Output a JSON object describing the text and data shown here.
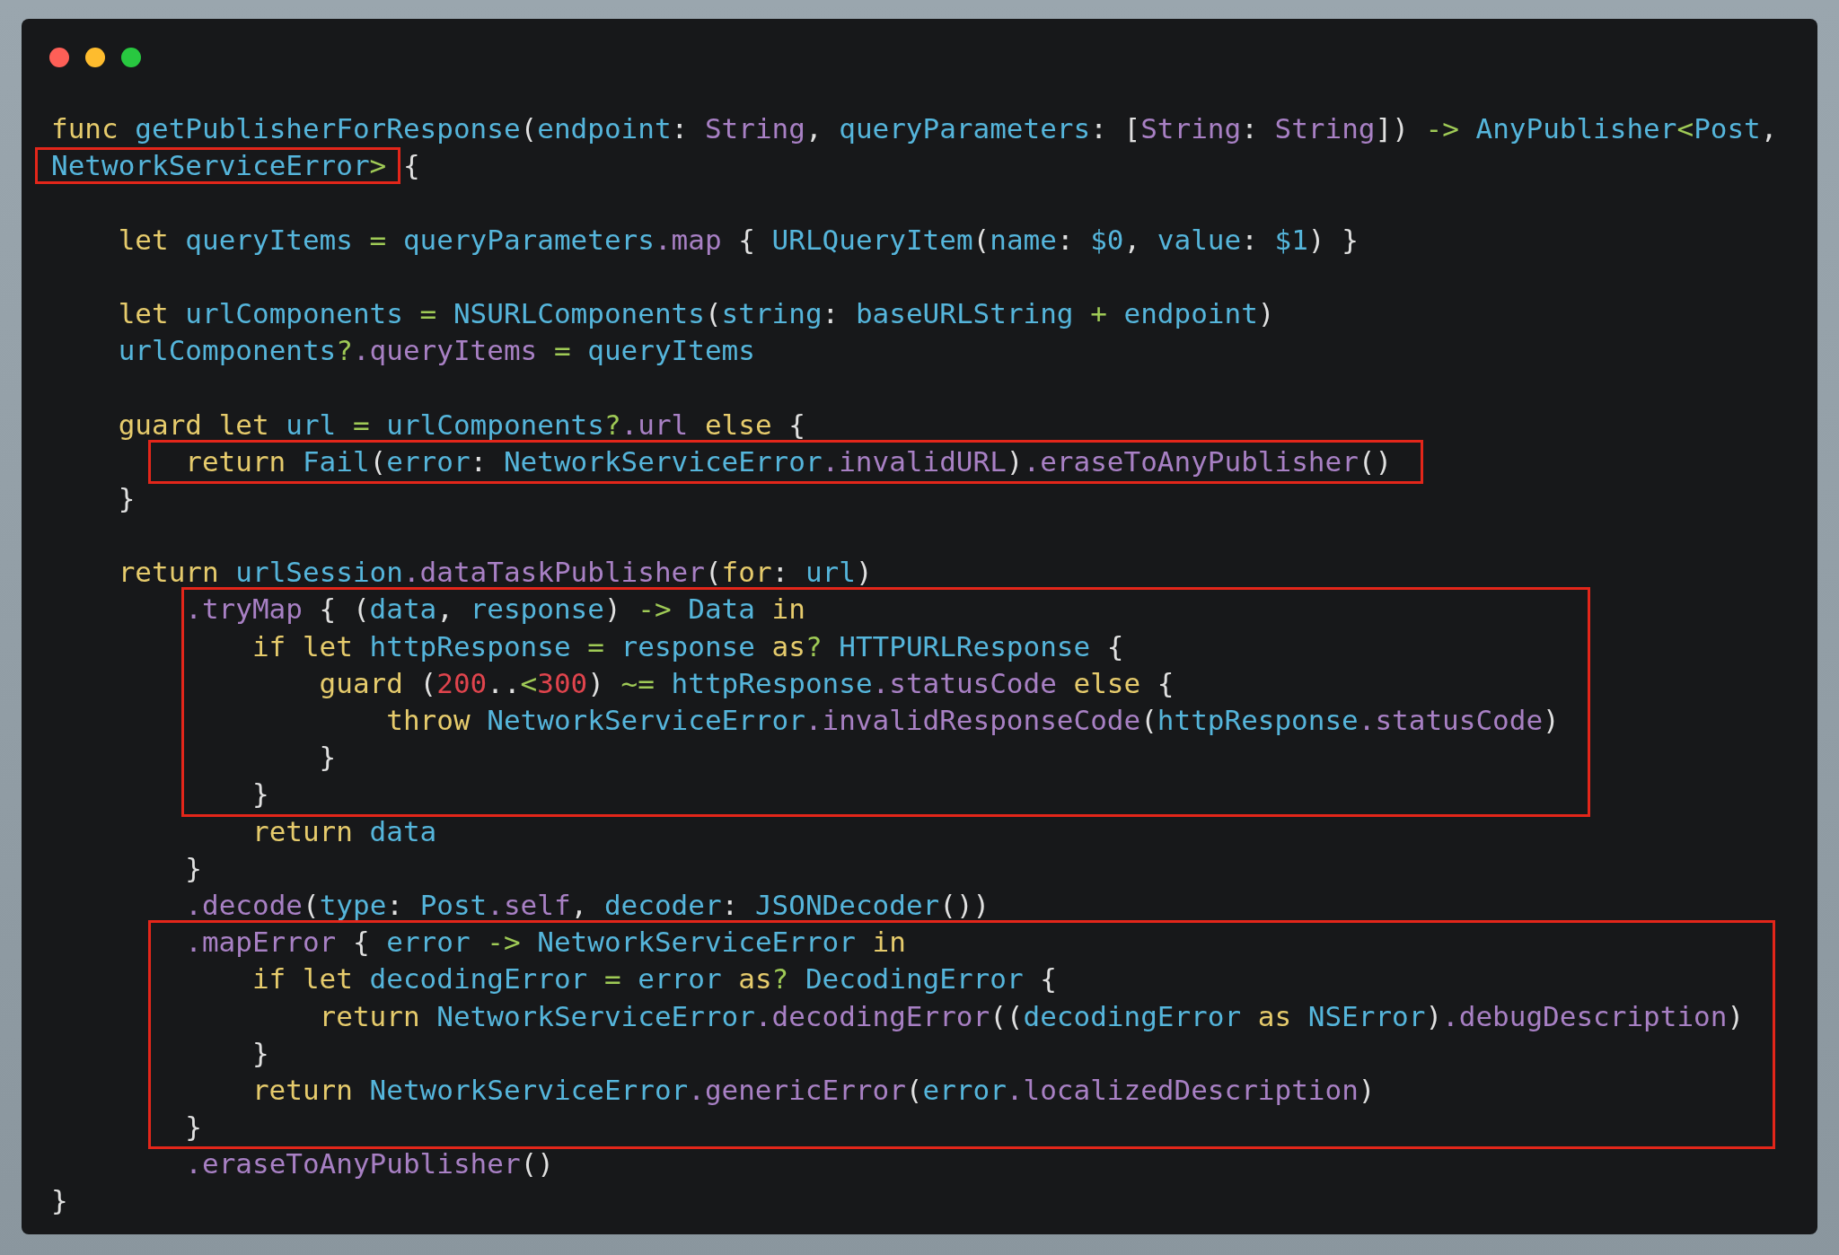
{
  "window": {
    "controls": [
      {
        "kind": "close"
      },
      {
        "kind": "minimize"
      },
      {
        "kind": "zoom"
      }
    ]
  },
  "code": [
    {
      "kind": "line",
      "tokens": [
        {
          "kind": "k",
          "text": "func "
        },
        {
          "kind": "i",
          "text": "getPublisherForResponse"
        },
        {
          "kind": "p",
          "text": "("
        },
        {
          "kind": "i",
          "text": "endpoint"
        },
        {
          "kind": "p",
          "text": ": "
        },
        {
          "kind": "m",
          "text": "String"
        },
        {
          "kind": "p",
          "text": ", "
        },
        {
          "kind": "i",
          "text": "queryParameters"
        },
        {
          "kind": "p",
          "text": ": ["
        },
        {
          "kind": "m",
          "text": "String"
        },
        {
          "kind": "p",
          "text": ": "
        },
        {
          "kind": "m",
          "text": "String"
        },
        {
          "kind": "p",
          "text": "]) "
        },
        {
          "kind": "o",
          "text": "->"
        },
        {
          "kind": "i",
          "text": " AnyPublisher"
        },
        {
          "kind": "o",
          "text": "<"
        },
        {
          "kind": "i",
          "text": "Post"
        },
        {
          "kind": "p",
          "text": ","
        }
      ]
    },
    {
      "kind": "line",
      "tokens": [
        {
          "kind": "box",
          "tokens": [
            {
              "kind": "i",
              "text": "NetworkServiceError"
            },
            {
              "kind": "o",
              "text": ">"
            }
          ]
        },
        {
          "kind": "p",
          "text": " {"
        }
      ]
    },
    {
      "kind": "blank"
    },
    {
      "kind": "line",
      "tokens": [
        {
          "kind": "k",
          "text": "    let "
        },
        {
          "kind": "i",
          "text": "queryItems"
        },
        {
          "kind": "o",
          "text": " = "
        },
        {
          "kind": "i",
          "text": "queryParameters"
        },
        {
          "kind": "m",
          "text": ".map"
        },
        {
          "kind": "p",
          "text": " { "
        },
        {
          "kind": "i",
          "text": "URLQueryItem"
        },
        {
          "kind": "p",
          "text": "("
        },
        {
          "kind": "i",
          "text": "name"
        },
        {
          "kind": "p",
          "text": ": "
        },
        {
          "kind": "i",
          "text": "$0"
        },
        {
          "kind": "p",
          "text": ", "
        },
        {
          "kind": "i",
          "text": "value"
        },
        {
          "kind": "p",
          "text": ": "
        },
        {
          "kind": "i",
          "text": "$1"
        },
        {
          "kind": "p",
          "text": ") }"
        }
      ]
    },
    {
      "kind": "blank"
    },
    {
      "kind": "line",
      "tokens": [
        {
          "kind": "k",
          "text": "    let "
        },
        {
          "kind": "i",
          "text": "urlComponents"
        },
        {
          "kind": "o",
          "text": " = "
        },
        {
          "kind": "i",
          "text": "NSURLComponents"
        },
        {
          "kind": "p",
          "text": "("
        },
        {
          "kind": "i",
          "text": "string"
        },
        {
          "kind": "p",
          "text": ": "
        },
        {
          "kind": "i",
          "text": "baseURLString"
        },
        {
          "kind": "o",
          "text": " + "
        },
        {
          "kind": "i",
          "text": "endpoint"
        },
        {
          "kind": "p",
          "text": ")"
        }
      ]
    },
    {
      "kind": "line",
      "tokens": [
        {
          "kind": "i",
          "text": "    urlComponents"
        },
        {
          "kind": "o",
          "text": "?"
        },
        {
          "kind": "m",
          "text": ".queryItems"
        },
        {
          "kind": "o",
          "text": " = "
        },
        {
          "kind": "i",
          "text": "queryItems"
        }
      ]
    },
    {
      "kind": "blank"
    },
    {
      "kind": "line",
      "tokens": [
        {
          "kind": "k",
          "text": "    guard let "
        },
        {
          "kind": "i",
          "text": "url"
        },
        {
          "kind": "o",
          "text": " = "
        },
        {
          "kind": "i",
          "text": "urlComponents"
        },
        {
          "kind": "o",
          "text": "?"
        },
        {
          "kind": "m",
          "text": ".url"
        },
        {
          "kind": "k",
          "text": " else "
        },
        {
          "kind": "p",
          "text": "{"
        }
      ]
    },
    {
      "kind": "box",
      "tight": false,
      "lines": [
        {
          "kind": "line",
          "tokens": [
            {
              "kind": "k",
              "text": "        return "
            },
            {
              "kind": "i",
              "text": "Fail"
            },
            {
              "kind": "p",
              "text": "("
            },
            {
              "kind": "i",
              "text": "error"
            },
            {
              "kind": "p",
              "text": ": "
            },
            {
              "kind": "i",
              "text": "NetworkServiceError"
            },
            {
              "kind": "m",
              "text": ".invalidURL"
            },
            {
              "kind": "p",
              "text": ")"
            },
            {
              "kind": "m",
              "text": ".eraseToAnyPublisher"
            },
            {
              "kind": "p",
              "text": "()"
            }
          ]
        }
      ]
    },
    {
      "kind": "line",
      "tokens": [
        {
          "kind": "p",
          "text": "    }"
        }
      ]
    },
    {
      "kind": "blank"
    },
    {
      "kind": "line",
      "tokens": [
        {
          "kind": "k",
          "text": "    return "
        },
        {
          "kind": "i",
          "text": "urlSession"
        },
        {
          "kind": "m",
          "text": ".dataTaskPublisher"
        },
        {
          "kind": "p",
          "text": "("
        },
        {
          "kind": "k",
          "text": "for"
        },
        {
          "kind": "p",
          "text": ": "
        },
        {
          "kind": "i",
          "text": "url"
        },
        {
          "kind": "p",
          "text": ")"
        }
      ]
    },
    {
      "kind": "box",
      "tight": true,
      "lines": [
        {
          "kind": "line",
          "tokens": [
            {
              "kind": "m",
              "text": "        .tryMap"
            },
            {
              "kind": "p",
              "text": " { ("
            },
            {
              "kind": "i",
              "text": "data"
            },
            {
              "kind": "p",
              "text": ", "
            },
            {
              "kind": "i",
              "text": "response"
            },
            {
              "kind": "p",
              "text": ") "
            },
            {
              "kind": "o",
              "text": "->"
            },
            {
              "kind": "i",
              "text": " Data"
            },
            {
              "kind": "k",
              "text": " in"
            }
          ]
        },
        {
          "kind": "line",
          "tokens": [
            {
              "kind": "k",
              "text": "            if let "
            },
            {
              "kind": "i",
              "text": "httpResponse"
            },
            {
              "kind": "o",
              "text": " = "
            },
            {
              "kind": "i",
              "text": "response"
            },
            {
              "kind": "k",
              "text": " as"
            },
            {
              "kind": "o",
              "text": "?"
            },
            {
              "kind": "i",
              "text": " HTTPURLResponse"
            },
            {
              "kind": "p",
              "text": " {"
            }
          ]
        },
        {
          "kind": "line",
          "tokens": [
            {
              "kind": "k",
              "text": "                guard "
            },
            {
              "kind": "p",
              "text": "("
            },
            {
              "kind": "n",
              "text": "200"
            },
            {
              "kind": "p",
              "text": ".."
            },
            {
              "kind": "o",
              "text": "<"
            },
            {
              "kind": "n",
              "text": "300"
            },
            {
              "kind": "p",
              "text": ") "
            },
            {
              "kind": "o",
              "text": "~="
            },
            {
              "kind": "i",
              "text": " httpResponse"
            },
            {
              "kind": "m",
              "text": ".statusCode"
            },
            {
              "kind": "k",
              "text": " else "
            },
            {
              "kind": "p",
              "text": "{"
            }
          ]
        },
        {
          "kind": "line",
          "tokens": [
            {
              "kind": "k",
              "text": "                    throw "
            },
            {
              "kind": "i",
              "text": "NetworkServiceError"
            },
            {
              "kind": "m",
              "text": ".invalidResponseCode"
            },
            {
              "kind": "p",
              "text": "("
            },
            {
              "kind": "i",
              "text": "httpResponse"
            },
            {
              "kind": "m",
              "text": ".statusCode"
            },
            {
              "kind": "p",
              "text": ")"
            }
          ]
        },
        {
          "kind": "line",
          "tokens": [
            {
              "kind": "p",
              "text": "                }"
            }
          ]
        },
        {
          "kind": "line",
          "tokens": [
            {
              "kind": "p",
              "text": "            }"
            }
          ]
        }
      ]
    },
    {
      "kind": "line",
      "tokens": [
        {
          "kind": "k",
          "text": "            return "
        },
        {
          "kind": "i",
          "text": "data"
        }
      ]
    },
    {
      "kind": "line",
      "tokens": [
        {
          "kind": "p",
          "text": "        }"
        }
      ]
    },
    {
      "kind": "line",
      "tokens": [
        {
          "kind": "m",
          "text": "        .decode"
        },
        {
          "kind": "p",
          "text": "("
        },
        {
          "kind": "i",
          "text": "type"
        },
        {
          "kind": "p",
          "text": ": "
        },
        {
          "kind": "i",
          "text": "Post"
        },
        {
          "kind": "m",
          "text": ".self"
        },
        {
          "kind": "p",
          "text": ", "
        },
        {
          "kind": "i",
          "text": "decoder"
        },
        {
          "kind": "p",
          "text": ": "
        },
        {
          "kind": "i",
          "text": "JSONDecoder"
        },
        {
          "kind": "p",
          "text": "())"
        }
      ]
    },
    {
      "kind": "box",
      "tight": false,
      "lines": [
        {
          "kind": "line",
          "tokens": [
            {
              "kind": "m",
              "text": "        .mapError"
            },
            {
              "kind": "p",
              "text": " { "
            },
            {
              "kind": "i",
              "text": "error"
            },
            {
              "kind": "o",
              "text": " -> "
            },
            {
              "kind": "i",
              "text": "NetworkServiceError"
            },
            {
              "kind": "k",
              "text": " in"
            }
          ]
        },
        {
          "kind": "line",
          "tokens": [
            {
              "kind": "k",
              "text": "            if let "
            },
            {
              "kind": "i",
              "text": "decodingError"
            },
            {
              "kind": "o",
              "text": " = "
            },
            {
              "kind": "i",
              "text": "error"
            },
            {
              "kind": "k",
              "text": " as"
            },
            {
              "kind": "o",
              "text": "?"
            },
            {
              "kind": "i",
              "text": " DecodingError"
            },
            {
              "kind": "p",
              "text": " {"
            }
          ]
        },
        {
          "kind": "line",
          "tokens": [
            {
              "kind": "k",
              "text": "                return "
            },
            {
              "kind": "i",
              "text": "NetworkServiceError"
            },
            {
              "kind": "m",
              "text": ".decodingError"
            },
            {
              "kind": "p",
              "text": "(("
            },
            {
              "kind": "i",
              "text": "decodingError"
            },
            {
              "kind": "k",
              "text": " as "
            },
            {
              "kind": "i",
              "text": "NSError"
            },
            {
              "kind": "p",
              "text": ")"
            },
            {
              "kind": "m",
              "text": ".debugDescription"
            },
            {
              "kind": "p",
              "text": ")"
            }
          ]
        },
        {
          "kind": "line",
          "tokens": [
            {
              "kind": "p",
              "text": "            }"
            }
          ]
        },
        {
          "kind": "line",
          "tokens": [
            {
              "kind": "k",
              "text": "            return "
            },
            {
              "kind": "i",
              "text": "NetworkServiceError"
            },
            {
              "kind": "m",
              "text": ".genericError"
            },
            {
              "kind": "p",
              "text": "("
            },
            {
              "kind": "i",
              "text": "error"
            },
            {
              "kind": "m",
              "text": ".localizedDescription"
            },
            {
              "kind": "p",
              "text": ")"
            }
          ]
        },
        {
          "kind": "line",
          "tokens": [
            {
              "kind": "p",
              "text": "        }"
            }
          ]
        }
      ]
    },
    {
      "kind": "line",
      "tokens": [
        {
          "kind": "m",
          "text": "        .eraseToAnyPublisher"
        },
        {
          "kind": "p",
          "text": "()"
        }
      ]
    },
    {
      "kind": "line",
      "tokens": [
        {
          "kind": "p",
          "text": "}"
        }
      ]
    }
  ]
}
